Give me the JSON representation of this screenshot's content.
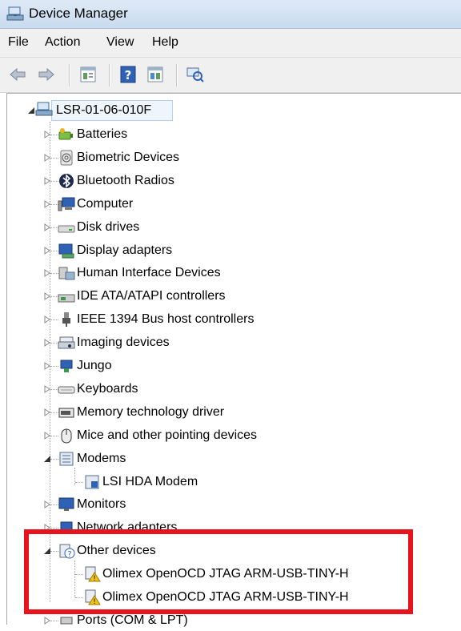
{
  "window": {
    "title": "Device Manager"
  },
  "menu": [
    "File",
    "Action",
    "View",
    "Help"
  ],
  "toolbar": {
    "buttons": [
      "back-arrow-icon",
      "forward-arrow-icon",
      "properties-icon",
      "help-icon",
      "update-driver-icon",
      "scan-hardware-icon"
    ]
  },
  "tree": {
    "root": "LSR-01-06-010F",
    "items": [
      {
        "label": "Batteries",
        "icon": "battery-icon"
      },
      {
        "label": "Biometric Devices",
        "icon": "fingerprint-icon"
      },
      {
        "label": "Bluetooth Radios",
        "icon": "bluetooth-icon"
      },
      {
        "label": "Computer",
        "icon": "computer-icon"
      },
      {
        "label": "Disk drives",
        "icon": "disk-drive-icon"
      },
      {
        "label": "Display adapters",
        "icon": "display-adapter-icon"
      },
      {
        "label": "Human Interface Devices",
        "icon": "hid-icon"
      },
      {
        "label": "IDE ATA/ATAPI controllers",
        "icon": "ide-controller-icon"
      },
      {
        "label": "IEEE 1394 Bus host controllers",
        "icon": "firewire-icon"
      },
      {
        "label": "Imaging devices",
        "icon": "scanner-icon"
      },
      {
        "label": "Jungo",
        "icon": "jungo-icon"
      },
      {
        "label": "Keyboards",
        "icon": "keyboard-icon"
      },
      {
        "label": "Memory technology driver",
        "icon": "memory-icon"
      },
      {
        "label": "Mice and other pointing devices",
        "icon": "mouse-icon"
      },
      {
        "label": "Modems",
        "icon": "modem-icon",
        "expanded": true
      },
      {
        "label": "LSI HDA Modem",
        "icon": "modem-device-icon",
        "child": true
      },
      {
        "label": "Monitors",
        "icon": "monitor-icon"
      },
      {
        "label": "Network adapters",
        "icon": "network-adapter-icon"
      },
      {
        "label": "Other devices",
        "icon": "unknown-device-icon",
        "expanded": true
      },
      {
        "label": "Olimex OpenOCD JTAG ARM-USB-TINY-H",
        "icon": "warning-device-icon",
        "child": true
      },
      {
        "label": "Olimex OpenOCD JTAG ARM-USB-TINY-H",
        "icon": "warning-device-icon",
        "child": true
      },
      {
        "label": "Ports (COM & LPT)",
        "icon": "port-icon"
      }
    ]
  },
  "colors": {
    "highlight": "#e8141d",
    "accent": "#1f5fb0",
    "warning": "#f2c40f"
  }
}
